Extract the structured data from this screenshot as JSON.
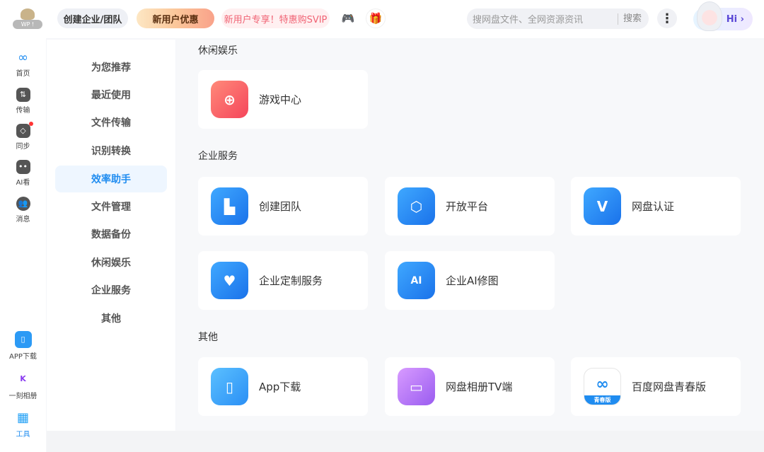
{
  "header": {
    "logo_text": "WP !",
    "create_team": "创建企业/团队",
    "new_user_offer": "新用户优惠",
    "svip_promo": "新用户专享！特惠购SVIP",
    "search_placeholder": "搜网盘文件、全网资源资讯",
    "search_button": "搜索",
    "hi_label": "Hi ›"
  },
  "rail": {
    "items": [
      {
        "label": "首页"
      },
      {
        "label": "传输"
      },
      {
        "label": "同步"
      },
      {
        "label": "AI看"
      },
      {
        "label": "消息"
      }
    ],
    "bottom": [
      {
        "label": "APP下载"
      },
      {
        "label": "一刻相册"
      },
      {
        "label": "工具"
      }
    ]
  },
  "subnav": {
    "items": [
      "为您推荐",
      "最近使用",
      "文件传输",
      "识别转换",
      "效率助手",
      "文件管理",
      "数据备份",
      "休闲娱乐",
      "企业服务",
      "其他"
    ],
    "active": "效率助手"
  },
  "sections": [
    {
      "title": "休闲娱乐",
      "cards": [
        {
          "label": "游戏中心"
        }
      ]
    },
    {
      "title": "企业服务",
      "cards": [
        {
          "label": "创建团队"
        },
        {
          "label": "开放平台"
        },
        {
          "label": "网盘认证",
          "icon_text": "V"
        },
        {
          "label": "企业定制服务"
        },
        {
          "label": "企业AI修图",
          "icon_text": "AI"
        }
      ]
    },
    {
      "title": "其他",
      "cards": [
        {
          "label": "App下载"
        },
        {
          "label": "网盘相册TV端"
        },
        {
          "label": "百度网盘青春版",
          "icon_text": "青春版"
        }
      ]
    }
  ],
  "colors": {
    "accent": "#1f8cf0",
    "promo": "#f06273"
  }
}
